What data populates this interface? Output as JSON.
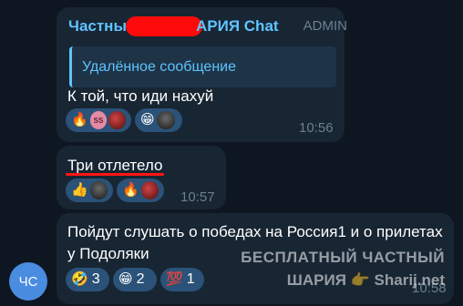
{
  "messages": [
    {
      "sender_prefix": "Частны",
      "sender_suffix": "АРИЯ Chat",
      "role": "ADMIN",
      "reply_quote": "Удалённое сообщение",
      "text": "К той, что иди нахуй",
      "reactions": [
        {
          "icon": "fire-emoji",
          "glyph": "🔥",
          "avatars": [
            "SS",
            ""
          ]
        },
        {
          "icon": "grinning-emoji",
          "glyph": "😁",
          "avatars": [
            ""
          ]
        }
      ],
      "time": "10:56"
    },
    {
      "text": "Три отлетело",
      "reactions": [
        {
          "icon": "thumbs-up-emoji",
          "glyph": "👍",
          "avatars": [
            ""
          ]
        },
        {
          "icon": "fire-emoji",
          "glyph": "🔥",
          "avatars": [
            ""
          ]
        }
      ],
      "time": "10:57"
    },
    {
      "text": "Пойдут слушать о победах на Россия1 и о прилетах у Подоляки",
      "reactions": [
        {
          "icon": "rofl-emoji",
          "glyph": "🤣",
          "count": "3"
        },
        {
          "icon": "grinning-emoji",
          "glyph": "😁",
          "count": "2"
        },
        {
          "icon": "hundred-points-emoji",
          "glyph": "💯",
          "count": "1"
        }
      ],
      "time": "10:58"
    }
  ],
  "sender_avatar_initials": "ЧС",
  "watermark": {
    "line1": "БЕСПЛАТНЫЙ ЧАСТНЫЙ",
    "line2": "ШАРИЯ 👉 Sharij.net"
  },
  "colors": {
    "background": "#0e1621",
    "bubble": "#182533",
    "accent": "#5ec4ff",
    "reaction_bg": "#2b5278",
    "redaction": "#ff0a0a"
  }
}
